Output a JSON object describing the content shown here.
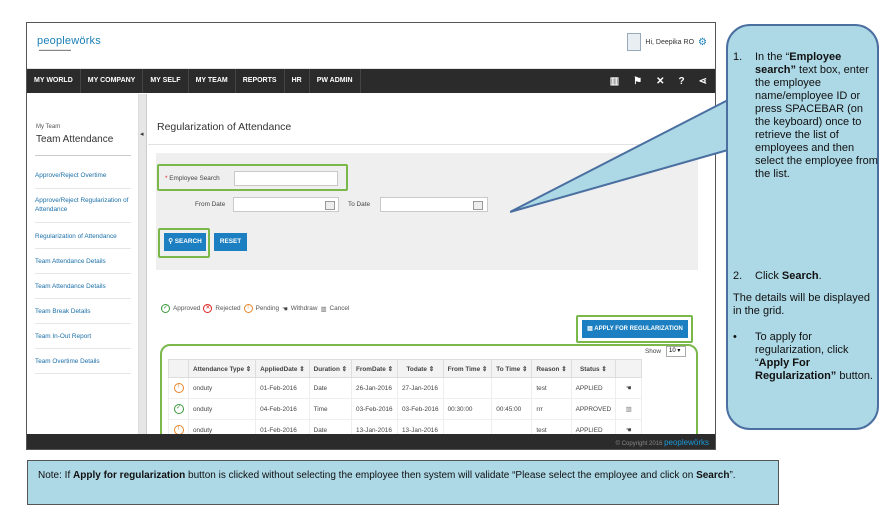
{
  "app": {
    "logo": "peoplewörks",
    "user_greeting": "Hi, Deepika RO",
    "nav": [
      "MY WORLD",
      "MY COMPANY",
      "MY SELF",
      "MY TEAM",
      "REPORTS",
      "HR",
      "PW ADMIN"
    ],
    "nav_icons": [
      "book-icon",
      "flag-icon",
      "tools-icon",
      "help-icon",
      "share-icon"
    ]
  },
  "sidebar": {
    "small": "My Team",
    "big": "Team Attendance",
    "links": [
      "Approve/Reject Overtime",
      "Approve/Reject Regularization of Attendance",
      "Regularization of Attendance",
      "Team Attendance Details",
      "Team Attendance Details",
      "Team Break Details",
      "Team In-Out Report",
      "Team Overtime Details"
    ]
  },
  "main": {
    "title": "Regularization of Attendance",
    "employee_search_label": "Employee Search",
    "from_date_label": "From Date",
    "to_date_label": "To Date",
    "search_button": "SEARCH",
    "reset_button": "RESET",
    "legend": {
      "approved": "Approved",
      "rejected": "Rejected",
      "pending": "Pending",
      "withdraw": "Withdraw",
      "cancel": "Cancel"
    },
    "apply_button": "APPLY FOR REGULARIZATION",
    "show_label": "Show",
    "show_value": "10",
    "columns": [
      "Attendance Type",
      "AppliedDate",
      "Duration",
      "FromDate",
      "Todate",
      "From Time",
      "To Time",
      "Reason",
      "Status"
    ],
    "rows": [
      {
        "type": "onduty",
        "applied": "01-Feb-2016",
        "duration": "Date",
        "from": "26-Jan-2016",
        "to": "27-Jan-2016",
        "ftime": "",
        "ttime": "",
        "reason": "test",
        "status": "APPLIED"
      },
      {
        "type": "onduty",
        "applied": "04-Feb-2016",
        "duration": "Time",
        "from": "03-Feb-2016",
        "to": "03-Feb-2016",
        "ftime": "00:30:00",
        "ttime": "00:45:00",
        "reason": "rrr",
        "status": "APPROVED"
      },
      {
        "type": "onduty",
        "applied": "01-Feb-2016",
        "duration": "Date",
        "from": "13-Jan-2016",
        "to": "13-Jan-2016",
        "ftime": "",
        "ttime": "",
        "reason": "test",
        "status": "APPLIED"
      }
    ],
    "copyright": "© Copyright 2016",
    "footer_logo": "peoplewörks"
  },
  "callout": {
    "step1_pre": "In the “",
    "step1_bold": "Employee search”",
    "step1_post": " text box, enter the employee name/employee ID or press SPACEBAR (on the keyboard) once to retrieve the list of employees and then select the employee from the list.",
    "step2_pre": "Click ",
    "step2_bold": "Search",
    "step2_post": ".",
    "details": "The details will be displayed in the grid.",
    "bullet_pre": "To apply for regularization, click “",
    "bullet_bold": "Apply For Regularization”",
    "bullet_post": " button."
  },
  "note": {
    "pre": "Note: If ",
    "bold1": "Apply for regularization",
    "mid": " button is clicked without selecting the employee then system will validate “Please select the employee and click on ",
    "bold2": "Search",
    "post": "”."
  },
  "colors": {
    "nav_bg": "#2b2b2b",
    "accent_blue": "#1b7fc1",
    "highlight_green": "#7ab84a",
    "callout_bg": "#add8e6"
  }
}
